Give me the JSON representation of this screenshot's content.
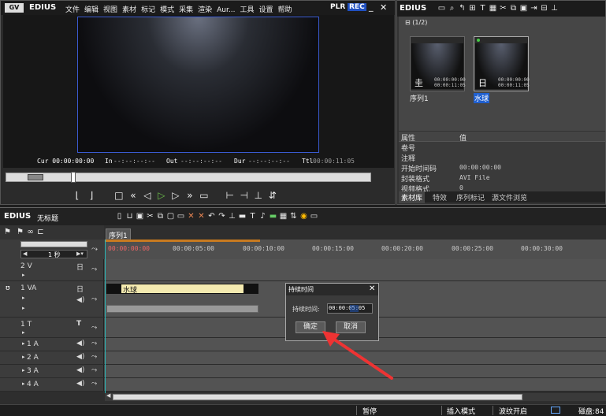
{
  "app": {
    "name": "EDIUS",
    "menu": [
      "文件",
      "编辑",
      "视图",
      "素材",
      "标记",
      "模式",
      "采集",
      "渲染",
      "Aur...",
      "工具",
      "设置",
      "帮助"
    ],
    "plr": "PLR",
    "rec": "REC"
  },
  "player": {
    "cur_label": "Cur",
    "cur": "00:00:00:00",
    "in_label": "In",
    "in": "--:--:--:--",
    "out_label": "Out",
    "out": "--:--:--:--",
    "dur_label": "Dur",
    "dur": "--:--:--:--",
    "ttl_label": "Ttl",
    "ttl": "00:00:11:05"
  },
  "bin": {
    "title": "EDIUS",
    "folder": "(1/2)",
    "clips": [
      {
        "name": "序列1",
        "in": "00:00:00:00",
        "out": "00:00:11:05"
      },
      {
        "name": "水球",
        "in": "00:00:00:00",
        "out": "00:00:11:05"
      }
    ]
  },
  "props": {
    "col1": "属性",
    "col2": "值",
    "rows": [
      {
        "k": "卷号",
        "v": ""
      },
      {
        "k": "注释",
        "v": ""
      },
      {
        "k": "开始时间码",
        "v": "00:00:00:00"
      },
      {
        "k": "封装格式",
        "v": "AVI File"
      },
      {
        "k": "视频格式",
        "v": "0"
      }
    ]
  },
  "bin_tabs": [
    "素材库",
    "特效",
    "序列标记",
    "源文件浏览"
  ],
  "timeline": {
    "app": "EDIUS",
    "project": "无标题",
    "seq_tab": "序列1",
    "scale": "1 秒",
    "ruler": [
      "00:00:00:00",
      "00:00:05:00",
      "00:00:10:00",
      "00:00:15:00",
      "00:00:20:00",
      "00:00:25:00",
      "00:00:30:00"
    ],
    "tracks": [
      {
        "name": "2 V"
      },
      {
        "name": "1 VA"
      },
      {
        "name": "1 T"
      },
      {
        "name": "1 A"
      },
      {
        "name": "2 A"
      },
      {
        "name": "3 A"
      },
      {
        "name": "4 A"
      }
    ],
    "clip": "水球"
  },
  "dialog": {
    "title": "持续时间",
    "label": "持续时间:",
    "value": "00:00:05:05",
    "ok": "确定",
    "cancel": "取消"
  },
  "status": {
    "pause": "暂停",
    "insert": "插入模式",
    "ripple": "波纹开启",
    "disk": "磁盘:84"
  }
}
